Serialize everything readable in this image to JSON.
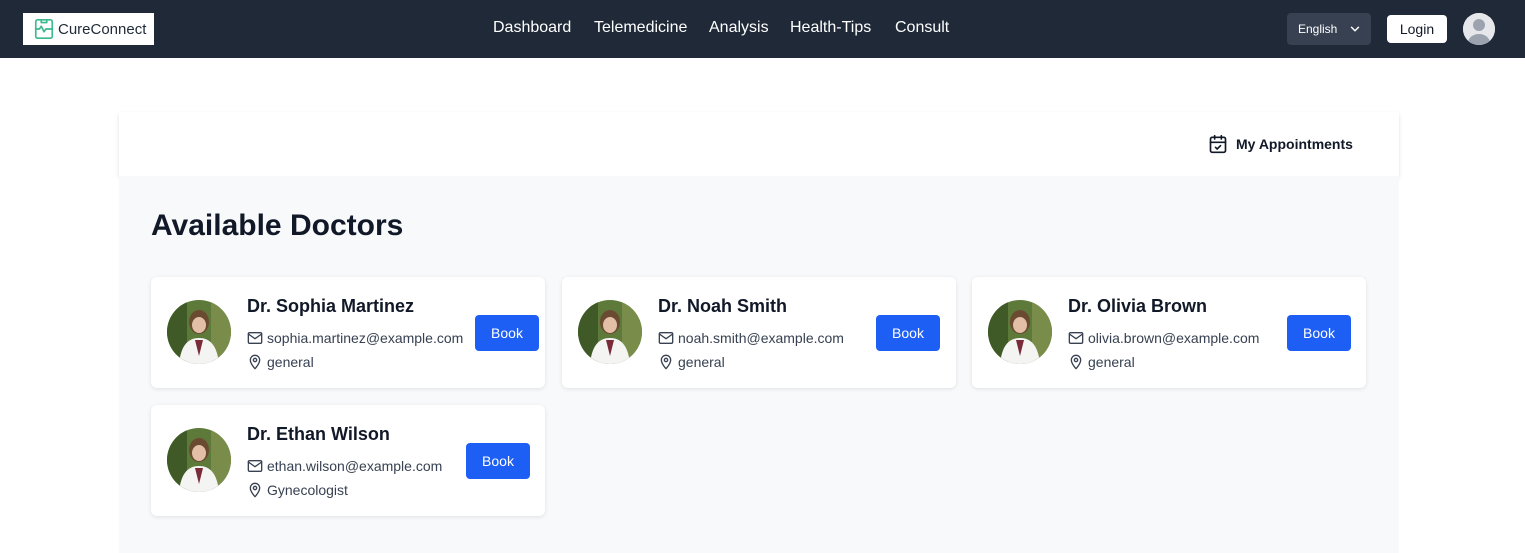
{
  "brand": {
    "name": "CureConnect",
    "accent": "#3bb98f"
  },
  "nav": {
    "items": [
      "Dashboard",
      "Telemedicine",
      "Analysis",
      "Health-Tips",
      "Consult"
    ]
  },
  "language": {
    "selected": "English"
  },
  "auth": {
    "login_label": "Login"
  },
  "appointments": {
    "label": "My Appointments"
  },
  "main": {
    "title": "Available Doctors"
  },
  "doctors": [
    {
      "name": "Dr. Sophia Martinez",
      "email": "sophia.martinez@example.com",
      "specialty": "general",
      "action": "Book"
    },
    {
      "name": "Dr. Noah Smith",
      "email": "noah.smith@example.com",
      "specialty": "general",
      "action": "Book"
    },
    {
      "name": "Dr. Olivia Brown",
      "email": "olivia.brown@example.com",
      "specialty": "general",
      "action": "Book"
    },
    {
      "name": "Dr. Ethan Wilson",
      "email": "ethan.wilson@example.com",
      "specialty": "Gynecologist",
      "action": "Book"
    }
  ],
  "colors": {
    "topbar": "#1f2937",
    "button": "#1d5ff5",
    "content_bg": "#f8f9fb"
  }
}
